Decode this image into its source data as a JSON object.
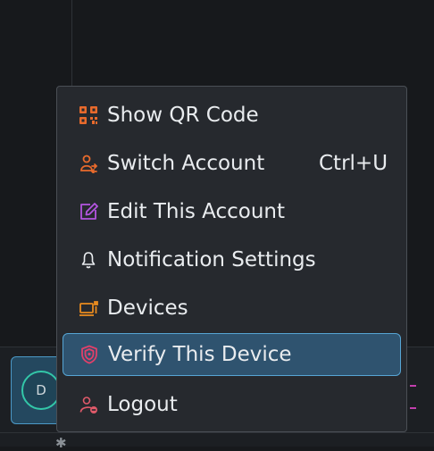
{
  "menu": {
    "items": [
      {
        "label": "Show QR Code",
        "icon": "qr-code-icon",
        "color": "#e86a2c"
      },
      {
        "label": "Switch Account",
        "shortcut": "Ctrl+U",
        "icon": "switch-account-icon",
        "color": "#e86a2c"
      },
      {
        "label": "Edit This Account",
        "icon": "edit-icon",
        "color": "#b455e0"
      },
      {
        "label": "Notification Settings",
        "icon": "bell-icon",
        "color": "#e9ecef"
      },
      {
        "label": "Devices",
        "icon": "devices-icon",
        "color": "#e88a1e"
      },
      {
        "label": "Verify This Device",
        "icon": "shield-icon",
        "color": "#e0406a",
        "selected": true
      },
      {
        "label": "Logout",
        "icon": "logout-icon",
        "color": "#e05a6a"
      }
    ]
  },
  "account": {
    "avatar_initial": "D"
  },
  "colors": {
    "selection_bg": "#2f536f",
    "selection_border": "#56a5d4",
    "avatar_ring": "#33c7a8"
  }
}
